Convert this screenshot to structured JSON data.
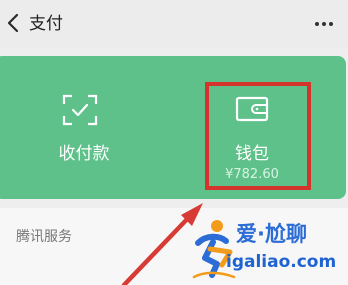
{
  "header": {
    "title": "支付",
    "back_icon": "chevron-left-icon",
    "more_icon": "more-horizontal-icon"
  },
  "pay_card": {
    "receive_label": "收付款",
    "receive_icon": "scan-icon",
    "wallet_label": "钱包",
    "wallet_balance": "¥782.60",
    "wallet_icon": "wallet-icon",
    "accent_color": "#5ec18a"
  },
  "section": {
    "tencent_services_label": "腾讯服务"
  },
  "annotation": {
    "highlight_color": "#d5342d"
  },
  "watermark": {
    "brand": "爱·尬聊",
    "domain": "igaliao.com"
  }
}
